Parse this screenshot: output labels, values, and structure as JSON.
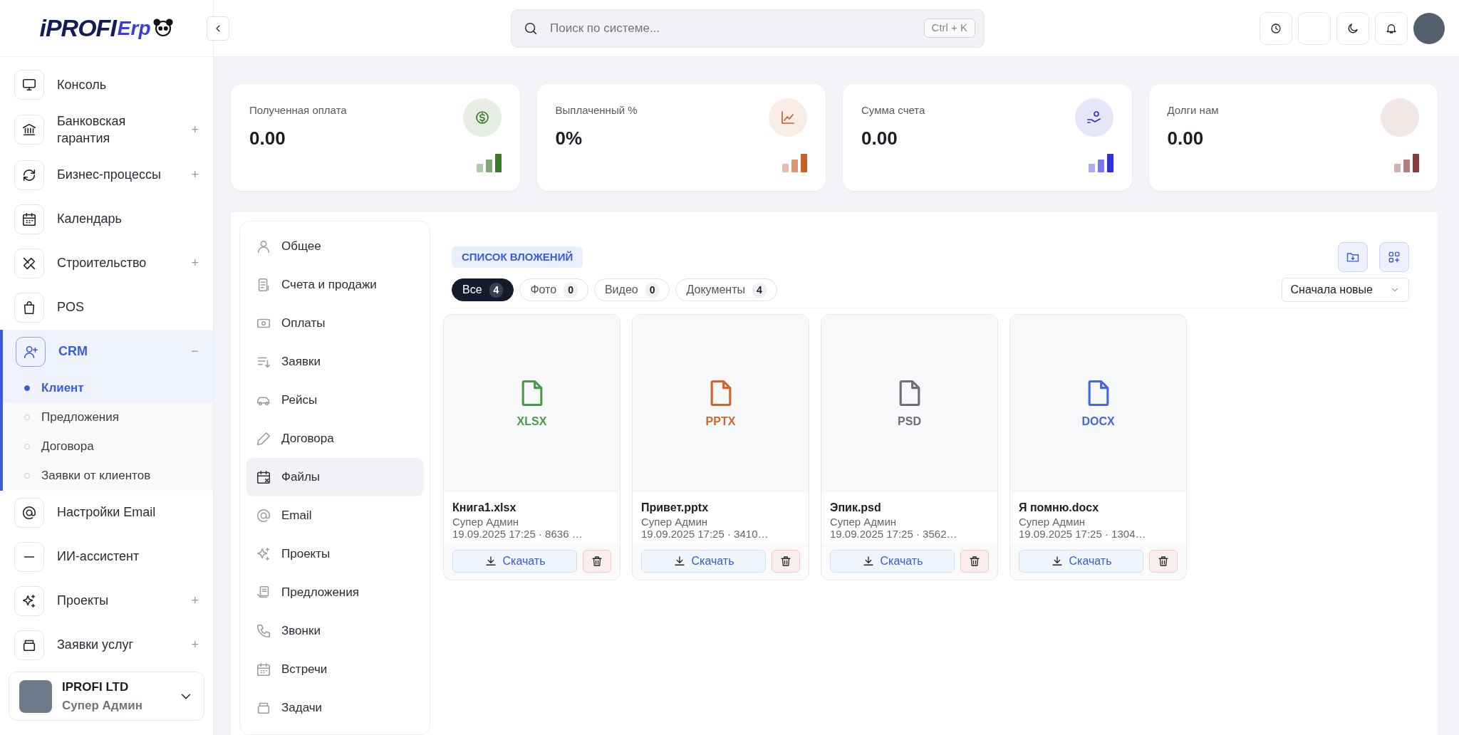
{
  "logo": {
    "brand": "iPROFI",
    "suffix": "Erp"
  },
  "sidebar": {
    "items": [
      {
        "label": "Консоль",
        "selected": false
      },
      {
        "label": "Банковская гарантия",
        "toggle": "+",
        "selected": false
      },
      {
        "label": "Бизнес-процессы",
        "toggle": "+",
        "selected": false
      },
      {
        "label": "Календарь",
        "selected": false
      },
      {
        "label": "Строительство",
        "toggle": "+",
        "selected": false
      },
      {
        "label": "POS",
        "selected": false
      },
      {
        "label": "CRM",
        "toggle": "−",
        "selected": true,
        "children": [
          {
            "label": "Клиент",
            "selected": true
          },
          {
            "label": "Предложения",
            "selected": false
          },
          {
            "label": "Договора",
            "selected": false
          },
          {
            "label": "Заявки от клиентов",
            "selected": false
          }
        ]
      },
      {
        "label": "Настройки Email",
        "selected": false
      },
      {
        "label": "ИИ-ассистент",
        "selected": false
      },
      {
        "label": "Проекты",
        "toggle": "+",
        "selected": false
      },
      {
        "label": "Заявки услуг",
        "toggle": "+",
        "selected": false
      }
    ],
    "user": {
      "company": "IPROFI LTD",
      "role": "Супер Админ"
    }
  },
  "search": {
    "placeholder": "Поиск по системе...",
    "shortcut": "Ctrl + K"
  },
  "stats": [
    {
      "label": "Полученная оплата",
      "value": "0.00",
      "color": "#3d7a2a"
    },
    {
      "label": "Выплаченный %",
      "value": "0%",
      "color": "#c8602a"
    },
    {
      "label": "Сумма счета",
      "value": "0.00",
      "color": "#3030d8"
    },
    {
      "label": "Долги нам",
      "value": "0.00",
      "color": "#8a3a3a"
    }
  ],
  "tabs": [
    {
      "label": "Общее",
      "selected": false
    },
    {
      "label": "Счета и продажи",
      "selected": false
    },
    {
      "label": "Оплаты",
      "selected": false
    },
    {
      "label": "Заявки",
      "selected": false
    },
    {
      "label": "Рейсы",
      "selected": false
    },
    {
      "label": "Договора",
      "selected": false
    },
    {
      "label": "Файлы",
      "selected": true
    },
    {
      "label": "Email",
      "selected": false
    },
    {
      "label": "Проекты",
      "selected": false
    },
    {
      "label": "Предложения",
      "selected": false
    },
    {
      "label": "Звонки",
      "selected": false
    },
    {
      "label": "Встречи",
      "selected": false
    },
    {
      "label": "Задачи",
      "selected": false
    }
  ],
  "attachments": {
    "title": "СПИСОК ВЛОЖЕНИЙ",
    "filters": [
      {
        "label": "Все",
        "count": "4",
        "selected": true
      },
      {
        "label": "Фото",
        "count": "0",
        "selected": false
      },
      {
        "label": "Видео",
        "count": "0",
        "selected": false
      },
      {
        "label": "Документы",
        "count": "4",
        "selected": false
      }
    ],
    "sort": "Сначала новые",
    "files": [
      {
        "ext": "XLSX",
        "color": "#4a9a4a",
        "name": "Книга1.xlsx",
        "author": "Супер Админ",
        "meta": "19.09.2025 17:25  ·  8636 …",
        "download": "Скачать"
      },
      {
        "ext": "PPTX",
        "color": "#d2642a",
        "name": "Привет.pptx",
        "author": "Супер Админ",
        "meta": "19.09.2025 17:25  ·  3410…",
        "download": "Скачать"
      },
      {
        "ext": "PSD",
        "color": "#6b6e78",
        "name": "Эпик.psd",
        "author": "Супер Админ",
        "meta": "19.09.2025 17:25  ·  3562…",
        "download": "Скачать"
      },
      {
        "ext": "DOCX",
        "color": "#4466e0",
        "name": "Я помню.docx",
        "author": "Супер Админ",
        "meta": "19.09.2025 17:25  ·  1304…",
        "download": "Скачать"
      }
    ]
  }
}
